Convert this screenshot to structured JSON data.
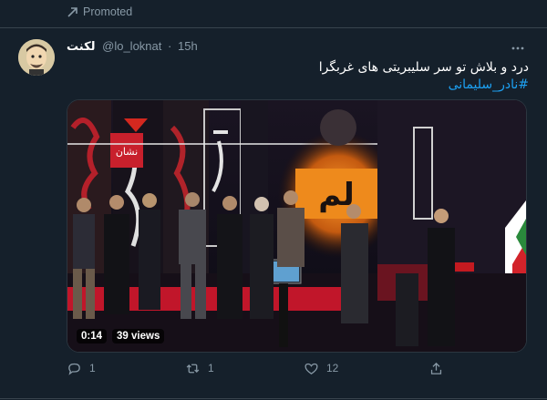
{
  "promoted": {
    "label": "Promoted"
  },
  "tweet": {
    "display_name": "لکنت",
    "handle": "@lo_loknat",
    "separator": "·",
    "time": "15h",
    "text": "درد و بلاش تو سر سلیبریتی های غربگرا",
    "hashtag": "#نادر_سلیمانی",
    "video": {
      "duration": "0:14",
      "views": "39 views"
    },
    "actions": {
      "replies": "1",
      "retweets": "1",
      "likes": "12"
    }
  },
  "colors": {
    "background": "#15202b",
    "secondary_text": "#8899a6",
    "accent": "#1da1f2",
    "divider": "#38444d"
  },
  "icons": [
    "promoted-icon",
    "more-icon",
    "reply-icon",
    "retweet-icon",
    "like-icon",
    "share-icon"
  ]
}
